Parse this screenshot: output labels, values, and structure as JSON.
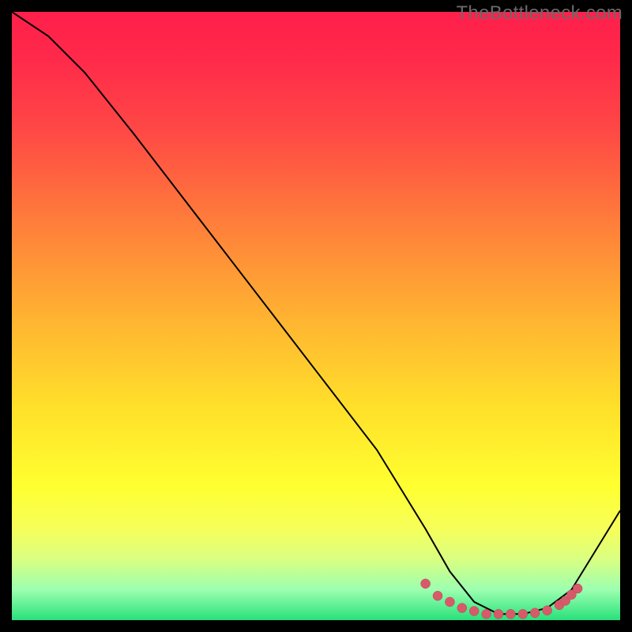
{
  "watermark": "TheBottleneck.com",
  "chart_data": {
    "type": "line",
    "title": "",
    "xlabel": "",
    "ylabel": "",
    "xlim": [
      0,
      100
    ],
    "ylim": [
      0,
      100
    ],
    "series": [
      {
        "name": "curve",
        "x": [
          0,
          6,
          12,
          20,
          30,
          40,
          50,
          60,
          68,
          72,
          76,
          80,
          84,
          88,
          92,
          100
        ],
        "y": [
          100,
          96,
          90,
          80,
          67,
          54,
          41,
          28,
          15,
          8,
          3,
          1,
          1,
          2,
          5,
          18
        ]
      }
    ],
    "markers": {
      "name": "bottom-cluster",
      "x": [
        68,
        70,
        72,
        74,
        76,
        78,
        80,
        82,
        84,
        86,
        88,
        90,
        91,
        92,
        93
      ],
      "y": [
        6,
        4,
        3,
        2,
        1.5,
        1,
        1,
        1,
        1,
        1.2,
        1.6,
        2.5,
        3.2,
        4.2,
        5.2
      ]
    },
    "gradient_stops": [
      {
        "pos": 0.0,
        "color": "#ff1f4b"
      },
      {
        "pos": 0.35,
        "color": "#ff7f3a"
      },
      {
        "pos": 0.65,
        "color": "#ffe02a"
      },
      {
        "pos": 0.9,
        "color": "#d9ff82"
      },
      {
        "pos": 1.0,
        "color": "#28e07a"
      }
    ]
  }
}
